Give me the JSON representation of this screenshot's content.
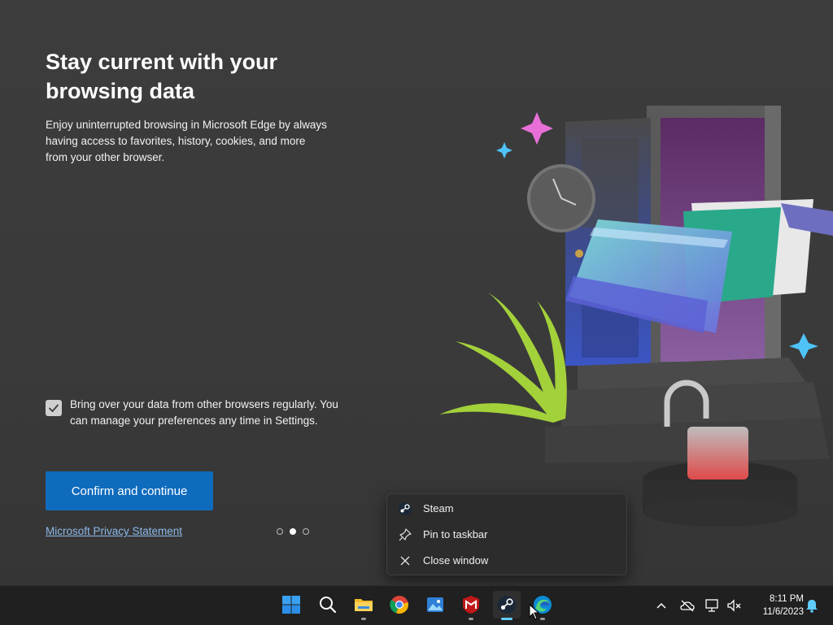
{
  "onboarding": {
    "title": "Stay current with your browsing data",
    "description": "Enjoy uninterrupted browsing in Microsoft Edge by always having access to favorites, history, cookies, and more from your other browser.",
    "checkbox": {
      "checked": true,
      "label": "Bring over your data from other browsers regularly. You can manage your preferences any time in Settings."
    },
    "confirm_label": "Confirm and continue",
    "privacy_link": "Microsoft Privacy Statement",
    "pager": {
      "total": 3,
      "current": 2
    }
  },
  "context_menu": {
    "items": [
      {
        "label": "Steam",
        "icon": "steam-icon"
      },
      {
        "label": "Pin to taskbar",
        "icon": "pin-icon"
      },
      {
        "label": "Close window",
        "icon": "close-icon"
      }
    ]
  },
  "taskbar": {
    "apps": [
      {
        "name": "start-button",
        "icon": "windows-icon"
      },
      {
        "name": "search-button",
        "icon": "search-icon"
      },
      {
        "name": "file-explorer",
        "icon": "folder-icon"
      },
      {
        "name": "chrome",
        "icon": "chrome-icon"
      },
      {
        "name": "photos",
        "icon": "photos-icon"
      },
      {
        "name": "mcafee",
        "icon": "mcafee-icon"
      },
      {
        "name": "steam",
        "icon": "steam-icon",
        "active": true
      },
      {
        "name": "edge",
        "icon": "edge-icon"
      }
    ],
    "time": "8:11 PM",
    "date": "11/6/2023"
  },
  "colors": {
    "accent": "#0f6cbd",
    "link": "#8cb8e8",
    "taskbar": "#202020",
    "indicator_active": "#60cdff"
  }
}
